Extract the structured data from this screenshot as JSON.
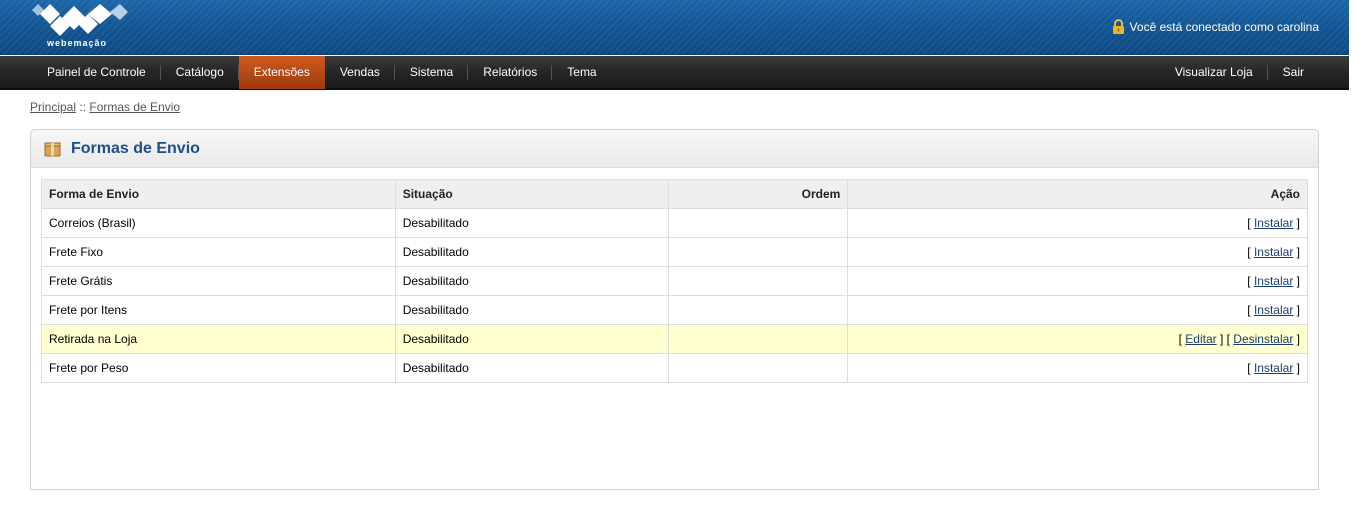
{
  "header": {
    "logo_text": "webemação",
    "login_text": "Você está conectado como carolina"
  },
  "menu": {
    "left": [
      "Painel de Controle",
      "Catálogo",
      "Extensões",
      "Vendas",
      "Sistema",
      "Relatórios",
      "Tema"
    ],
    "active": "Extensões",
    "right": [
      "Visualizar Loja",
      "Sair"
    ]
  },
  "breadcrumb": {
    "home": "Principal",
    "separator": " :: ",
    "current": "Formas de Envio"
  },
  "box": {
    "title": "Formas de Envio"
  },
  "table": {
    "headers": [
      "Forma de Envio",
      "Situação",
      "Ordem",
      "Ação"
    ],
    "rows": [
      {
        "name": "Correios (Brasil)",
        "status": "Desabilitado",
        "order": "",
        "actions": [
          "Instalar"
        ]
      },
      {
        "name": "Frete Fixo",
        "status": "Desabilitado",
        "order": "",
        "actions": [
          "Instalar"
        ]
      },
      {
        "name": "Frete Grátis",
        "status": "Desabilitado",
        "order": "",
        "actions": [
          "Instalar"
        ]
      },
      {
        "name": "Frete por Itens",
        "status": "Desabilitado",
        "order": "",
        "actions": [
          "Instalar"
        ]
      },
      {
        "name": "Retirada na Loja",
        "status": "Desabilitado",
        "order": "",
        "actions": [
          "Editar",
          "Desinstalar"
        ]
      },
      {
        "name": "Frete por Peso",
        "status": "Desabilitado",
        "order": "",
        "actions": [
          "Instalar"
        ]
      }
    ]
  },
  "colors": {
    "header_blue": "#10528f",
    "active_menu": "#cf5a1f",
    "title_blue": "#1f4d87",
    "highlight_row": "#ffffd0"
  }
}
